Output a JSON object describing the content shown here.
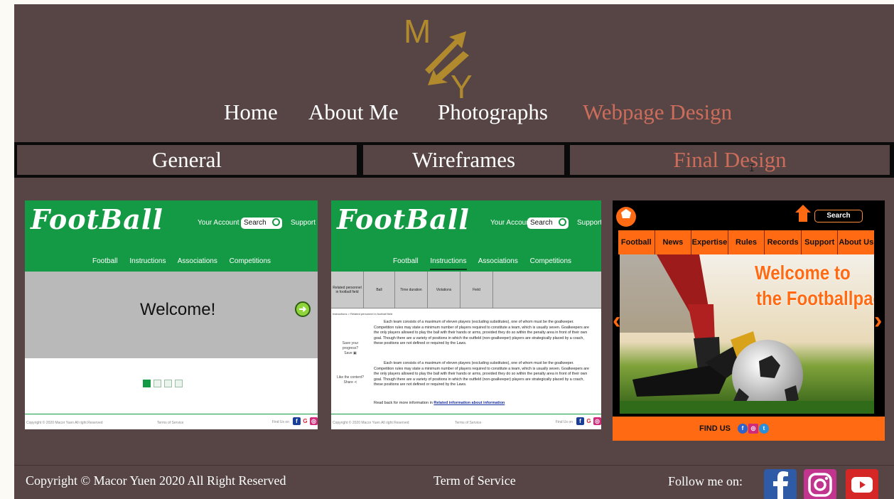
{
  "logo": {
    "letters": [
      "M",
      "Y"
    ]
  },
  "main_nav": [
    {
      "label": "Home",
      "active": false
    },
    {
      "label": "About Me",
      "active": false
    },
    {
      "label": "Photographs",
      "active": false
    },
    {
      "label": "Webpage Design",
      "active": true
    }
  ],
  "sub_nav": [
    {
      "label": "General",
      "active": false
    },
    {
      "label": "Wireframes",
      "active": false
    },
    {
      "label": "Final Design",
      "active": true
    }
  ],
  "cursor_glyph": "I",
  "thumb1": {
    "brand": "FootBall",
    "account": "Your Account",
    "search": "Search",
    "support": "Support",
    "menu": [
      "Football",
      "Instructions",
      "Associations",
      "Competitions"
    ],
    "welcome": "Welcome!",
    "footer": {
      "copyright": "Copyright © 2020 Macor Yuen All right Reserved",
      "terms": "Terms of Service",
      "find": "Find Us on"
    }
  },
  "thumb2": {
    "brand": "FootBall",
    "account": "Your Account",
    "search": "Search",
    "support": "Support",
    "menu": [
      "Football",
      "Instructions",
      "Associations",
      "Competitions"
    ],
    "selected_menu": "Instructions",
    "table": [
      "Related personnel in football field",
      "Ball",
      "Time duration",
      "Violations",
      "Field"
    ],
    "breadcrumb": "Instructions > Related personnel in football field",
    "paragraph": "Each team consists of a maximum of eleven players (excluding substitutes), one of whom must be the goalkeeper. Competition rules may state a minimum number of players required to constitute a team, which is usually seven. Goalkeepers are the only players allowed to play the ball with their hands or arms, provided they do so within the penalty area in front of their own goal. Though there are a variety of positions in which the outfield (non-goalkeeper) players are strategically placed by a coach, these positions are not defined or required by the Laws.",
    "save_label": "Save your progress?",
    "save_btn": "Save",
    "share_label": "Like the content?",
    "share_btn": "Share",
    "read_back": "Read back for more information in",
    "read_link": "Related information about information",
    "footer": {
      "copyright": "Copyright © 2020 Macor Yuen All right Reserved",
      "terms": "Terms of Service",
      "find": "Find Us on"
    }
  },
  "thumb3": {
    "search": "Search",
    "menu": [
      "Football",
      "News",
      "Expertise",
      "Rules",
      "Records",
      "Support",
      "About Us"
    ],
    "welcome_line1": "Welcome to",
    "welcome_line2": "the Footballpage!",
    "find_us": "FIND US"
  },
  "footer": {
    "copyright": "Copyright ©  Macor Yuen 2020 All Right Reserved",
    "terms": "Term of Service",
    "follow": "Follow me on:"
  },
  "colors": {
    "background": "#564544",
    "active": "#cc6d5b",
    "green": "#149a45",
    "orange": "#ff6a13"
  },
  "icons": [
    "facebook-icon",
    "instagram-icon",
    "youtube-icon",
    "google-plus-icon",
    "home-icon",
    "arrow-right-icon",
    "share-icon",
    "save-icon"
  ]
}
